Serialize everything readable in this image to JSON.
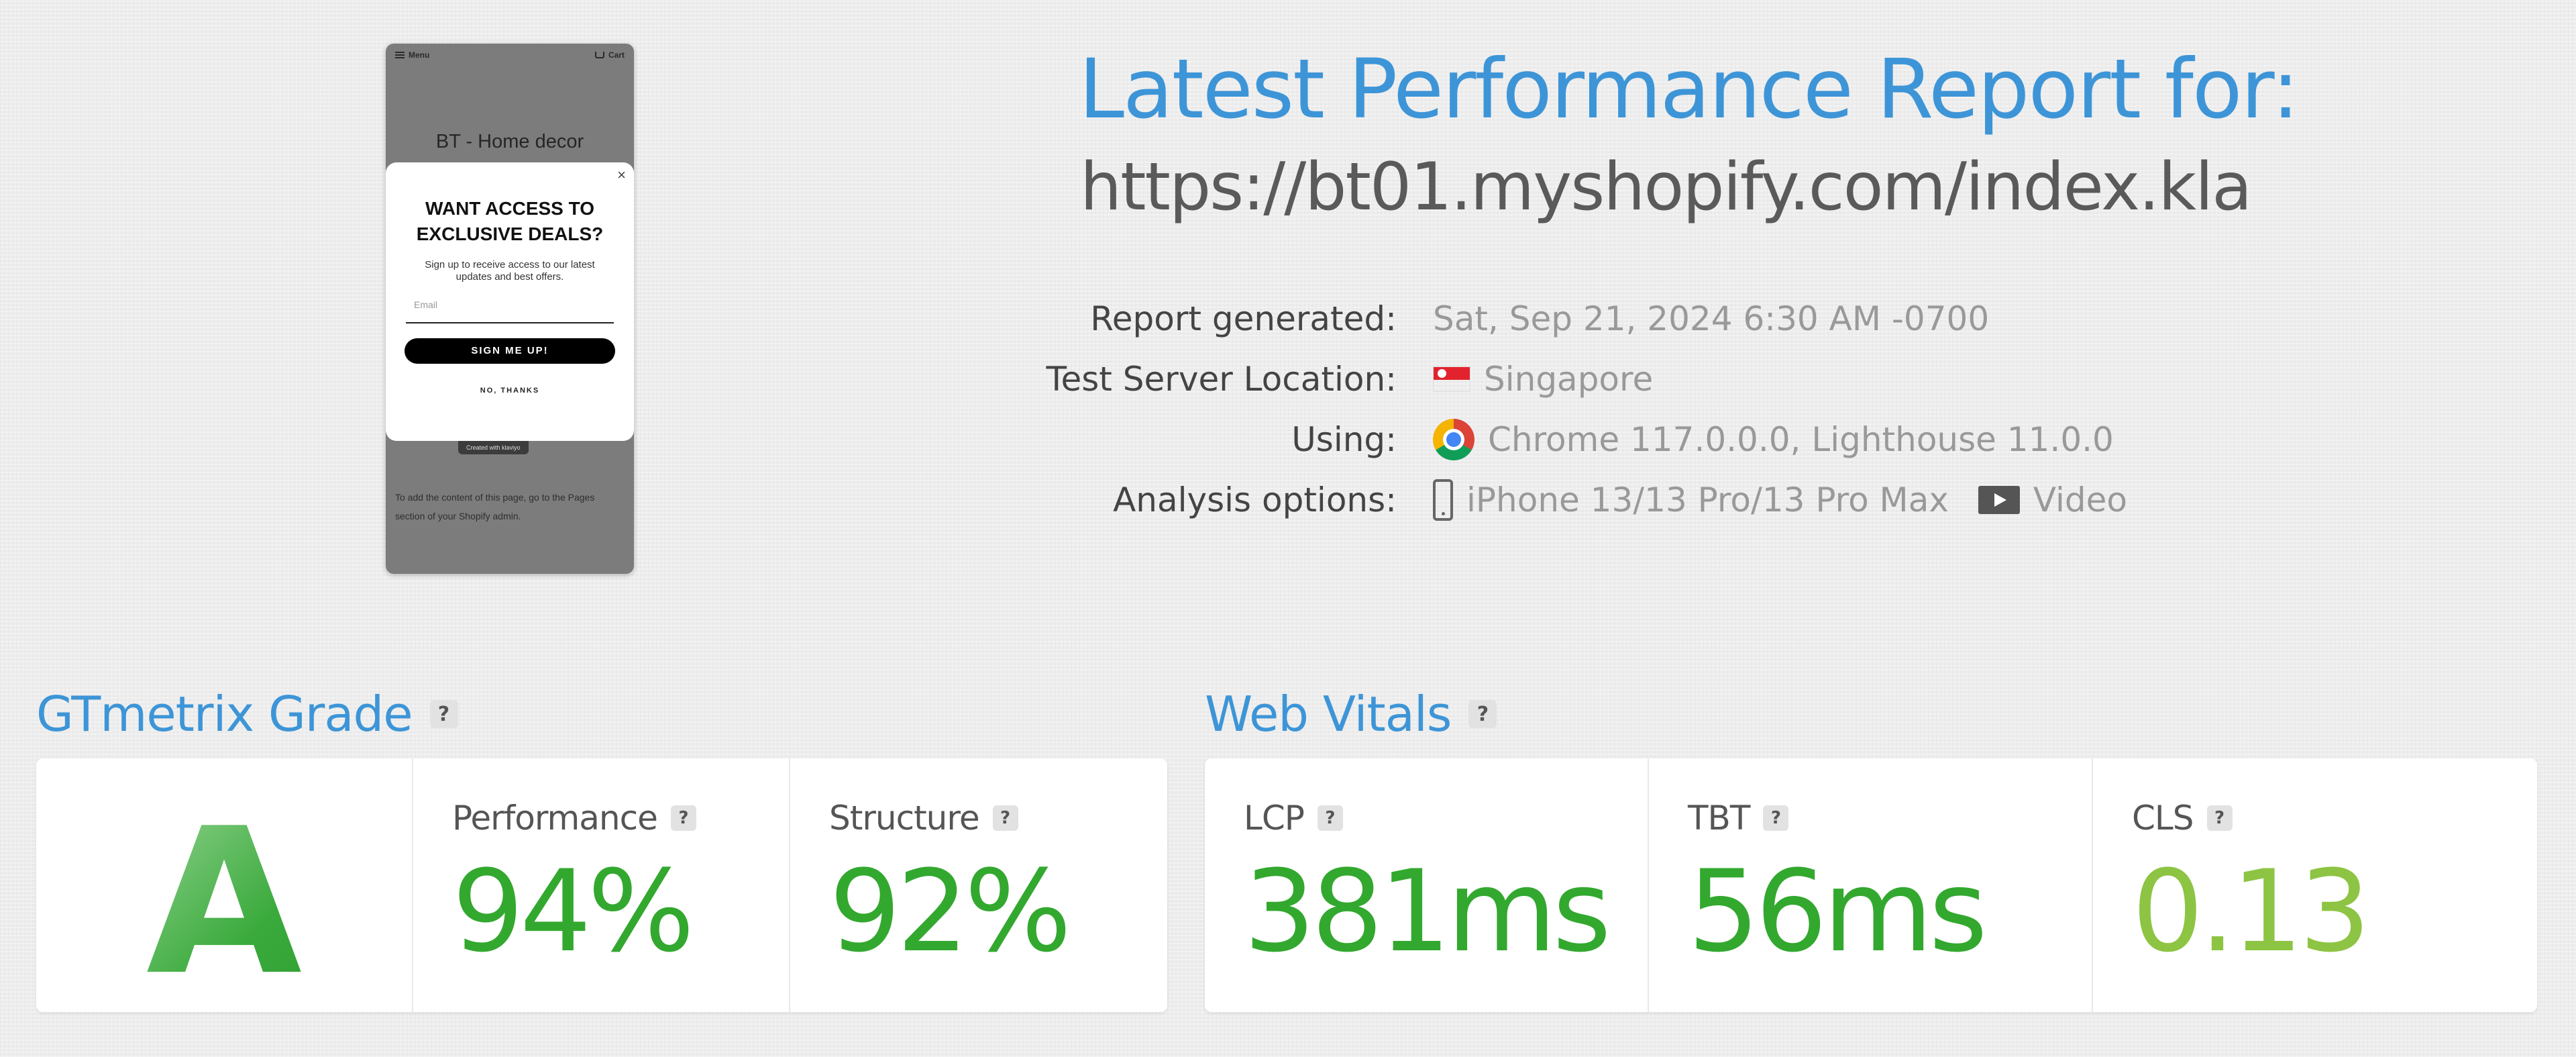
{
  "screenshot": {
    "menu_label": "Menu",
    "cart_label": "Cart",
    "store_name": "BT - Home decor",
    "popup": {
      "close_glyph": "×",
      "title": "WANT ACCESS TO EXCLUSIVE DEALS?",
      "subtitle": "Sign up to receive access to our latest updates and best offers.",
      "email_placeholder": "Email",
      "signup_button": "SIGN ME UP!",
      "dismiss_link": "NO, THANKS"
    },
    "badge": "Created with klaviyo",
    "body_text": "To add the content of this page, go to the Pages section of your Shopify admin."
  },
  "report": {
    "title": "Latest Performance Report for:",
    "url": "https://bt01.myshopify.com/index.kla",
    "meta": [
      {
        "label": "Report generated:",
        "value": "Sat, Sep 21, 2024 6:30 AM -0700"
      },
      {
        "label": "Test Server Location:",
        "value": "Singapore",
        "icon": "singapore-flag-icon"
      },
      {
        "label": "Using:",
        "value": "Chrome 117.0.0.0, Lighthouse 11.0.0",
        "icon": "chrome-icon"
      },
      {
        "label": "Analysis options:",
        "value": "iPhone 13/13 Pro/13 Pro Max",
        "icon": "mobile-phone-icon",
        "extra": "Video",
        "extra_icon": "video-icon"
      }
    ]
  },
  "grade": {
    "title": "GTmetrix Grade",
    "help": "?",
    "letter": "A",
    "performance_label": "Performance",
    "performance_value": "94%",
    "structure_label": "Structure",
    "structure_value": "92%"
  },
  "vitals": {
    "title": "Web Vitals",
    "help": "?",
    "lcp_label": "LCP",
    "lcp_value": "381ms",
    "tbt_label": "TBT",
    "tbt_value": "56ms",
    "cls_label": "CLS",
    "cls_value": "0.13"
  },
  "colors": {
    "title_blue": "#3d95d7",
    "good_green": "#33a82f",
    "cls_green": "#8dc443"
  }
}
